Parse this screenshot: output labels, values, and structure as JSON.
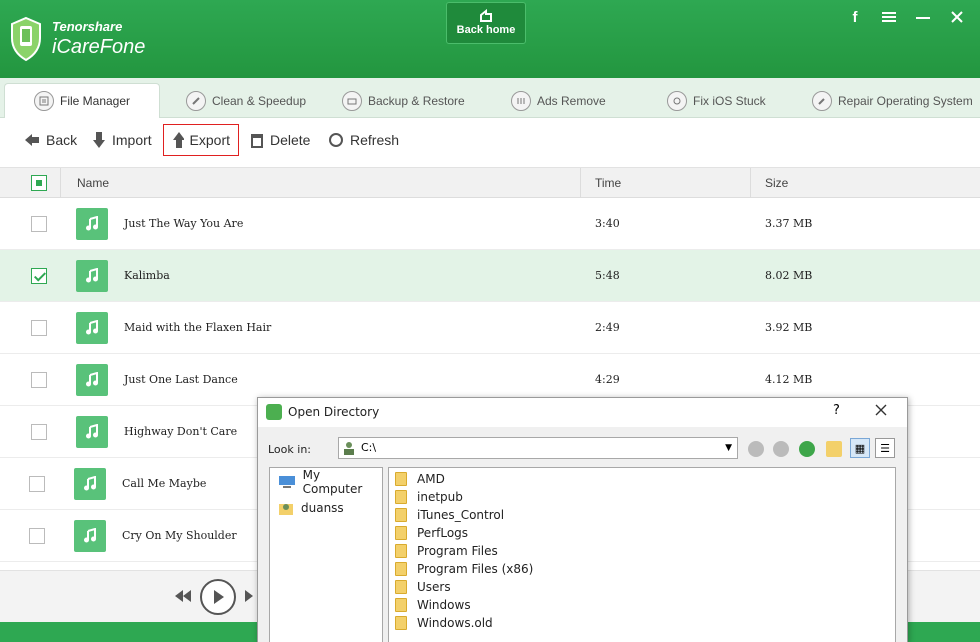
{
  "app": {
    "brand_small": "Tenorshare",
    "brand_big": "iCareFone",
    "back_home": "Back home"
  },
  "tabs": [
    {
      "label": "File Manager",
      "icon": "file-manager-icon"
    },
    {
      "label": "Clean & Speedup",
      "icon": "rocket-icon"
    },
    {
      "label": "Backup & Restore",
      "icon": "backup-icon"
    },
    {
      "label": "Ads Remove",
      "icon": "ads-icon"
    },
    {
      "label": "Fix iOS Stuck",
      "icon": "refresh-icon"
    },
    {
      "label": "Repair Operating System",
      "icon": "wrench-icon"
    }
  ],
  "toolbar": {
    "back": "Back",
    "import": "Import",
    "export": "Export",
    "delete": "Delete",
    "refresh": "Refresh"
  },
  "table": {
    "headers": {
      "name": "Name",
      "time": "Time",
      "size": "Size"
    },
    "rows": [
      {
        "name": "Just The Way You Are",
        "time": "3:40",
        "size": "3.37 MB",
        "checked": false
      },
      {
        "name": "Kalimba",
        "time": "5:48",
        "size": "8.02 MB",
        "checked": true
      },
      {
        "name": "Maid with the Flaxen Hair",
        "time": "2:49",
        "size": "3.92 MB",
        "checked": false
      },
      {
        "name": "Just One Last Dance",
        "time": "4:29",
        "size": "4.12 MB",
        "checked": false
      },
      {
        "name": "Highway Don't Care",
        "time": "",
        "size": "",
        "checked": false
      },
      {
        "name": "Call Me Maybe",
        "time": "",
        "size": "",
        "checked": false
      },
      {
        "name": "Cry On My Shoulder",
        "time": "",
        "size": "",
        "checked": false
      }
    ]
  },
  "dialog": {
    "title": "Open Directory",
    "help": "?",
    "look_in_label": "Look in:",
    "look_in_value": "C:\\",
    "sidebar": [
      "My Computer",
      "duanss"
    ],
    "folders": [
      "AMD",
      "inetpub",
      "iTunes_Control",
      "PerfLogs",
      "Program Files",
      "Program Files (x86)",
      "Users",
      "Windows",
      "Windows.old"
    ]
  },
  "colors": {
    "accent": "#2ea852",
    "selected_row": "#e3f3e7",
    "export_outline": "#e02020"
  }
}
